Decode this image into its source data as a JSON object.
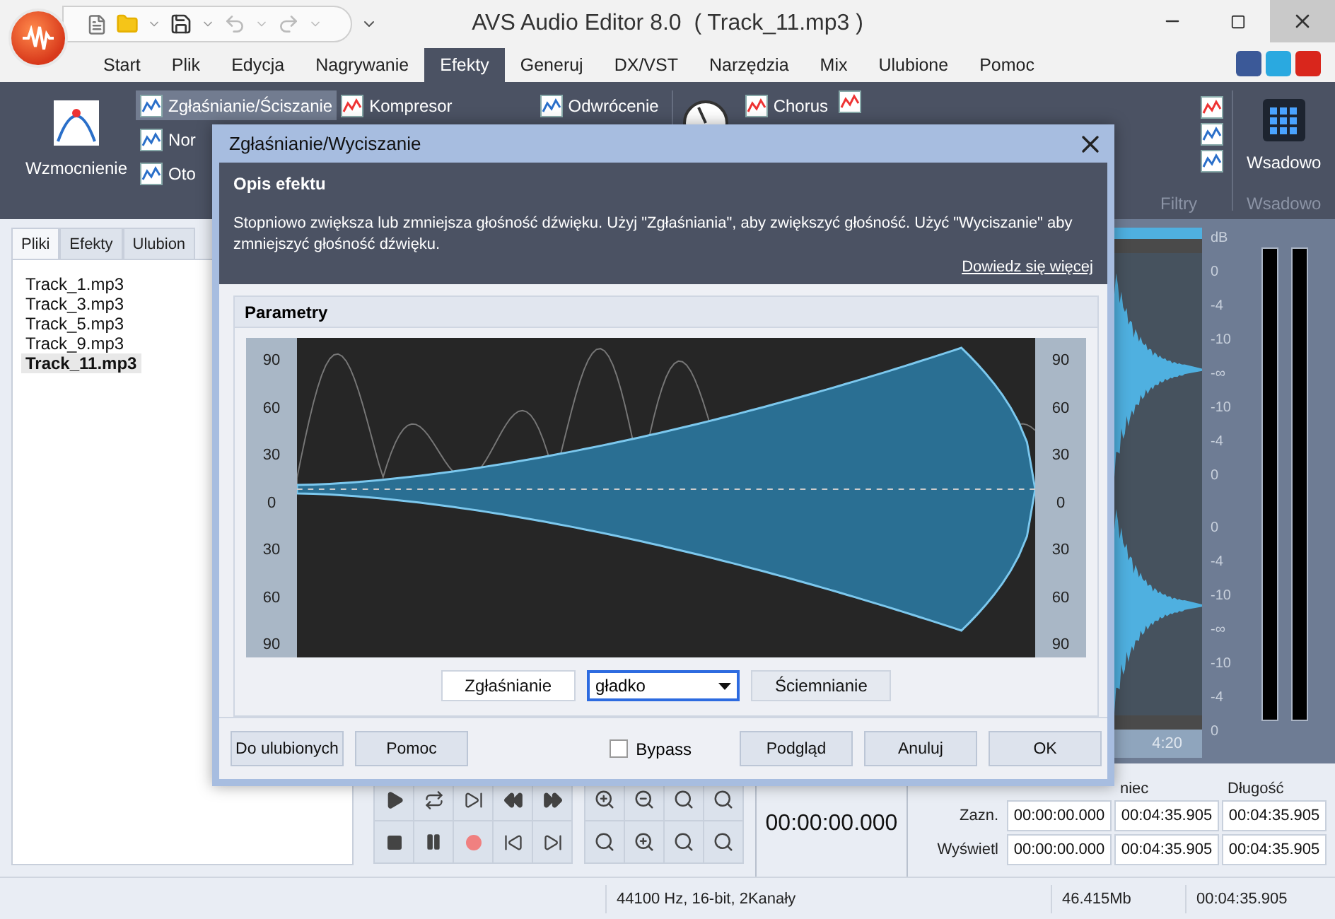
{
  "window": {
    "title": "AVS Audio Editor 8.0  ( Track_11.mp3 )"
  },
  "menu_tabs": [
    {
      "label": "Start",
      "selected": false
    },
    {
      "label": "Plik",
      "selected": false
    },
    {
      "label": "Edycja",
      "selected": false
    },
    {
      "label": "Nagrywanie",
      "selected": false
    },
    {
      "label": "Efekty",
      "selected": true
    },
    {
      "label": "Generuj",
      "selected": false
    },
    {
      "label": "DX/VST",
      "selected": false
    },
    {
      "label": "Narzędzia",
      "selected": false
    },
    {
      "label": "Mix",
      "selected": false
    },
    {
      "label": "Ulubione",
      "selected": false
    },
    {
      "label": "Pomoc",
      "selected": false
    }
  ],
  "ribbon": {
    "amplify_button": "Wzmocnienie",
    "small_buttons": [
      {
        "label": "Zgłaśnianie/Ściszanie",
        "selected": true
      },
      {
        "label": "Nor",
        "selected": false
      },
      {
        "label": "Oto",
        "selected": false
      }
    ],
    "compressor_button": "Kompresor",
    "invert_button": "Odwrócenie",
    "chorus_button": "Chorus",
    "filters_group_label": "Filtry",
    "batch_button": "Wsadowo",
    "batch_group_label": "Wsadowo"
  },
  "side_panel": {
    "tabs": [
      {
        "label": "Pliki",
        "selected": true
      },
      {
        "label": "Efekty",
        "selected": false
      },
      {
        "label": "Ulubion",
        "selected": false
      }
    ],
    "files": [
      {
        "name": "Track_1.mp3",
        "selected": false
      },
      {
        "name": "Track_3.mp3",
        "selected": false
      },
      {
        "name": "Track_5.mp3",
        "selected": false
      },
      {
        "name": "Track_9.mp3",
        "selected": false
      },
      {
        "name": "Track_11.mp3",
        "selected": true
      }
    ]
  },
  "waveform_panel": {
    "db_label": "dB",
    "channels": [
      {
        "scale_labels": [
          "0",
          "-4",
          "-10",
          "-∞",
          "-10",
          "-4",
          "0"
        ]
      },
      {
        "scale_labels": [
          "0",
          "-4",
          "-10",
          "-∞",
          "-10",
          "-4",
          "0"
        ]
      }
    ],
    "time_label": "4:20"
  },
  "transport": {
    "position": "00:00:00.000"
  },
  "time_table": {
    "columns": [
      "niec",
      "Długość"
    ],
    "rows": [
      {
        "label": "Zazn.",
        "values": [
          "00:00:00.000",
          "00:04:35.905",
          "00:04:35.905"
        ]
      },
      {
        "label": "Wyświetl",
        "values": [
          "00:00:00.000",
          "00:04:35.905",
          "00:04:35.905"
        ]
      }
    ]
  },
  "status_bar": [
    "44100 Hz, 16-bit, 2Kanały",
    "46.415Mb",
    "00:04:35.905"
  ],
  "dialog": {
    "title": "Zgłaśnianie/Wyciszanie",
    "description": {
      "heading": "Opis efektu",
      "text": "Stopniowo zwiększa lub zmniejsza głośność dźwięku. Użyj \"Zgłaśniania\", aby zwiększyć głośność. Użyć \"Wyciszanie\" aby zmniejszyć głośność dźwięku.",
      "link": "Dowiedz się więcej"
    },
    "parameters": {
      "heading": "Parametry",
      "left_scale": [
        "90",
        "60",
        "30",
        "0",
        "30",
        "60",
        "90"
      ],
      "right_scale": [
        "90",
        "60",
        "30",
        "0",
        "30",
        "60",
        "90"
      ],
      "fade_in_button": "Zgłaśnianie",
      "curve_select": {
        "value": "gładko"
      },
      "fade_out_button": "Ściemnianie"
    },
    "footer": {
      "favorites_button": "Do ulubionych",
      "help_button": "Pomoc",
      "bypass": {
        "label": "Bypass",
        "checked": false
      },
      "preview_button": "Podgląd",
      "cancel_button": "Anuluj",
      "ok_button": "OK"
    }
  }
}
